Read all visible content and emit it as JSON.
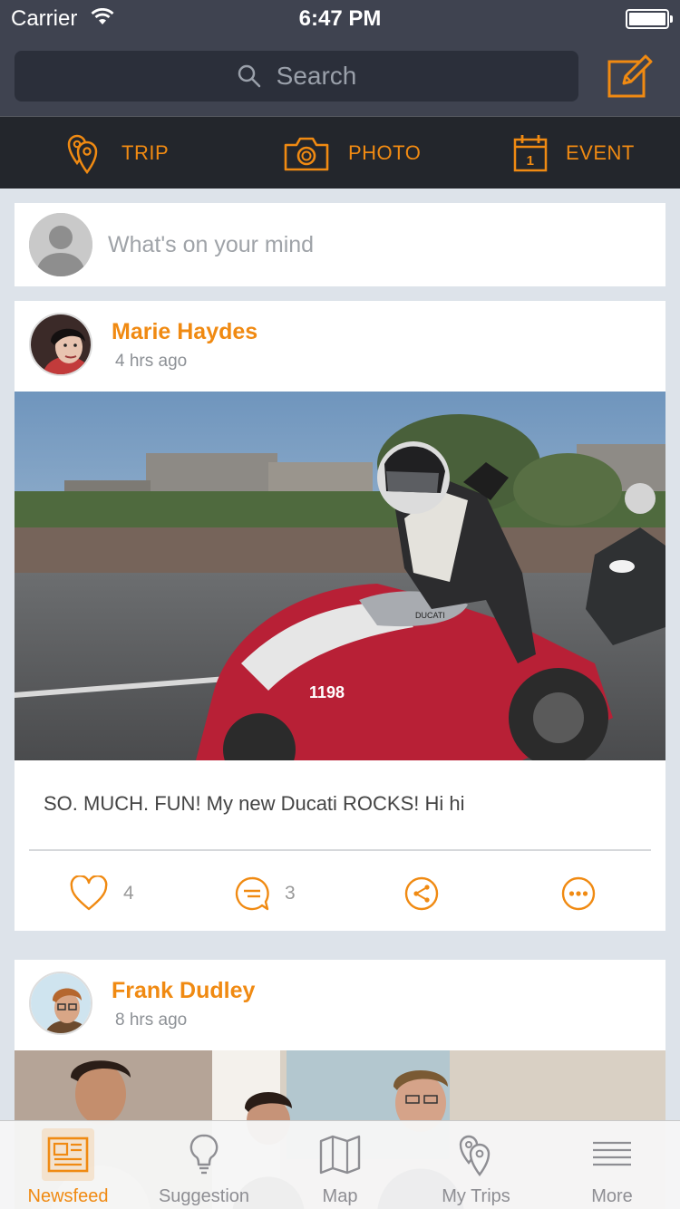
{
  "status_bar": {
    "carrier": "Carrier",
    "time": "6:47 PM"
  },
  "nav": {
    "search_placeholder": "Search"
  },
  "actions": [
    {
      "label": "TRIP",
      "icon": "location-pins-icon"
    },
    {
      "label": "PHOTO",
      "icon": "camera-icon"
    },
    {
      "label": "EVENT",
      "icon": "calendar-icon",
      "day": "1"
    }
  ],
  "composer": {
    "placeholder": "What's on your mind"
  },
  "posts": [
    {
      "author": "Marie Haydes",
      "time": "4 hrs ago",
      "text": "SO. MUCH. FUN! My new Ducati ROCKS! Hi hi",
      "likes": "4",
      "comments": "3",
      "bike_badge": "1198",
      "tank_logo": "DUCATI"
    },
    {
      "author": "Frank Dudley",
      "time": "8 hrs ago"
    }
  ],
  "tabs": [
    {
      "label": "Newsfeed",
      "icon": "newspaper-icon",
      "active": true
    },
    {
      "label": "Suggestion",
      "icon": "lightbulb-icon",
      "active": false
    },
    {
      "label": "Map",
      "icon": "map-icon",
      "active": false
    },
    {
      "label": "My Trips",
      "icon": "location-pins-icon",
      "active": false
    },
    {
      "label": "More",
      "icon": "hamburger-menu-icon",
      "active": false
    }
  ],
  "colors": {
    "accent": "#f08a12",
    "nav_bg": "#3f4350",
    "action_bg": "#23262c",
    "feed_bg": "#dde3ea"
  }
}
